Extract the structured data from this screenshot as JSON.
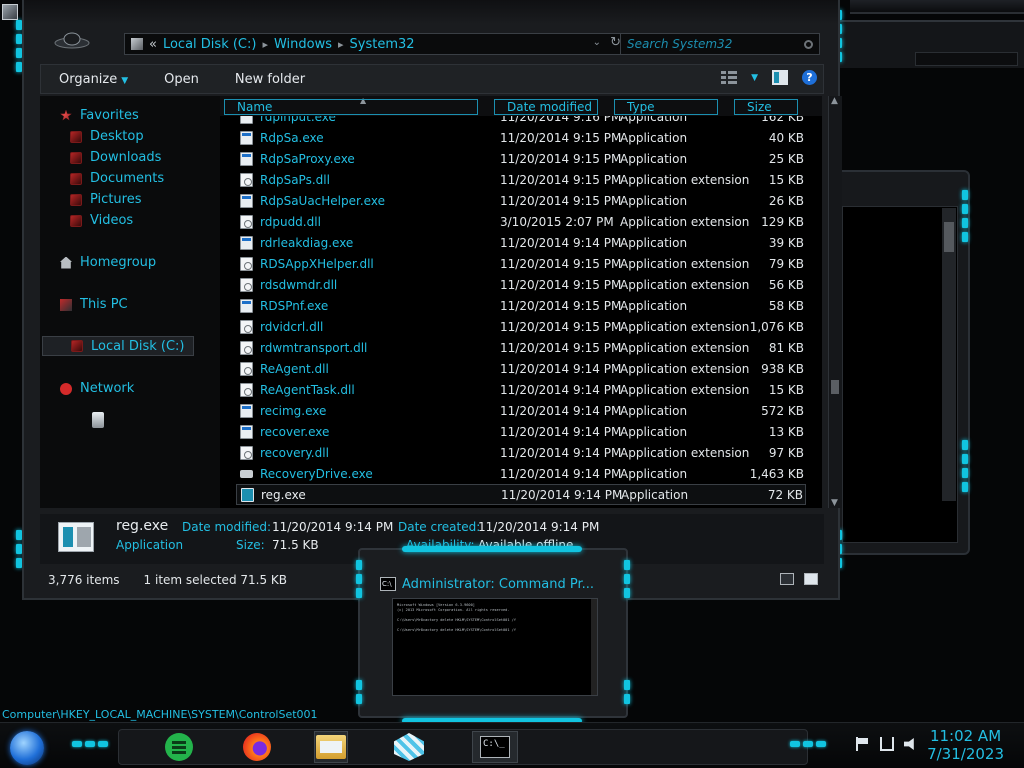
{
  "address": {
    "overflow": "«",
    "crumbs": [
      "Local Disk (C:)",
      "Windows",
      "System32"
    ],
    "separator": "▸"
  },
  "search": {
    "placeholder": "Search System32"
  },
  "toolbar": {
    "organize": "Organize",
    "open": "Open",
    "new_folder": "New folder"
  },
  "nav": {
    "favorites": "Favorites",
    "desktop": "Desktop",
    "downloads": "Downloads",
    "documents": "Documents",
    "pictures": "Pictures",
    "videos": "Videos",
    "homegroup": "Homegroup",
    "this_pc": "This PC",
    "local_disk": "Local Disk (C:)",
    "network": "Network"
  },
  "columns": {
    "name": "Name",
    "date": "Date modified",
    "type": "Type",
    "size": "Size"
  },
  "files": [
    {
      "name": "rdpinput.exe",
      "date": "11/20/2014 9:16 PM",
      "type": "Application",
      "size": "162 KB",
      "icon": "exe"
    },
    {
      "name": "RdpSa.exe",
      "date": "11/20/2014 9:15 PM",
      "type": "Application",
      "size": "40 KB",
      "icon": "exe"
    },
    {
      "name": "RdpSaProxy.exe",
      "date": "11/20/2014 9:15 PM",
      "type": "Application",
      "size": "25 KB",
      "icon": "exe"
    },
    {
      "name": "RdpSaPs.dll",
      "date": "11/20/2014 9:15 PM",
      "type": "Application extension",
      "size": "15 KB",
      "icon": "dll"
    },
    {
      "name": "RdpSaUacHelper.exe",
      "date": "11/20/2014 9:15 PM",
      "type": "Application",
      "size": "26 KB",
      "icon": "exe"
    },
    {
      "name": "rdpudd.dll",
      "date": "3/10/2015 2:07 PM",
      "type": "Application extension",
      "size": "129 KB",
      "icon": "dll"
    },
    {
      "name": "rdrleakdiag.exe",
      "date": "11/20/2014 9:14 PM",
      "type": "Application",
      "size": "39 KB",
      "icon": "exe"
    },
    {
      "name": "RDSAppXHelper.dll",
      "date": "11/20/2014 9:15 PM",
      "type": "Application extension",
      "size": "79 KB",
      "icon": "dll"
    },
    {
      "name": "rdsdwmdr.dll",
      "date": "11/20/2014 9:15 PM",
      "type": "Application extension",
      "size": "56 KB",
      "icon": "dll"
    },
    {
      "name": "RDSPnf.exe",
      "date": "11/20/2014 9:15 PM",
      "type": "Application",
      "size": "58 KB",
      "icon": "exe"
    },
    {
      "name": "rdvidcrl.dll",
      "date": "11/20/2014 9:15 PM",
      "type": "Application extension",
      "size": "1,076 KB",
      "icon": "dll"
    },
    {
      "name": "rdwmtransport.dll",
      "date": "11/20/2014 9:15 PM",
      "type": "Application extension",
      "size": "81 KB",
      "icon": "dll"
    },
    {
      "name": "ReAgent.dll",
      "date": "11/20/2014 9:14 PM",
      "type": "Application extension",
      "size": "938 KB",
      "icon": "dll"
    },
    {
      "name": "ReAgentTask.dll",
      "date": "11/20/2014 9:14 PM",
      "type": "Application extension",
      "size": "15 KB",
      "icon": "dll"
    },
    {
      "name": "recimg.exe",
      "date": "11/20/2014 9:14 PM",
      "type": "Application",
      "size": "572 KB",
      "icon": "exe"
    },
    {
      "name": "recover.exe",
      "date": "11/20/2014 9:14 PM",
      "type": "Application",
      "size": "13 KB",
      "icon": "exe"
    },
    {
      "name": "recovery.dll",
      "date": "11/20/2014 9:14 PM",
      "type": "Application extension",
      "size": "97 KB",
      "icon": "dll"
    },
    {
      "name": "RecoveryDrive.exe",
      "date": "11/20/2014 9:14 PM",
      "type": "Application",
      "size": "1,463 KB",
      "icon": "drive"
    },
    {
      "name": "reg.exe",
      "date": "11/20/2014 9:14 PM",
      "type": "Application",
      "size": "72 KB",
      "icon": "reg",
      "selected": true
    }
  ],
  "details": {
    "filename": "reg.exe",
    "kind": "Application",
    "date_modified_label": "Date modified:",
    "date_modified": "11/20/2014 9:14 PM",
    "size_label": "Size:",
    "size": "71.5 KB",
    "date_created_label": "Date created:",
    "date_created": "11/20/2014 9:14 PM",
    "availability_label": "Availability:",
    "availability": "Available offline"
  },
  "status": {
    "count": "3,776 items",
    "selection": "1 item selected  71.5 KB"
  },
  "cmd": {
    "title": "Administrator: Command Pr...",
    "lines": "Microsoft Windows [Version 6.3.9600]\n(c) 2013 Microsoft Corporation. All rights reserved.\n\nC:\\Users\\Mr8cactory delete HKLM\\SYSTEM\\ControlSet001 /f\n\nC:\\Users\\Mr8cactory delete HKLM\\SYSTEM\\ControlSet001 /f"
  },
  "registry_path": "Computer\\HKEY_LOCAL_MACHINE\\SYSTEM\\ControlSet001",
  "clock": {
    "time": "11:02 AM",
    "date": "7/31/2023"
  },
  "theme": {
    "accent": "#23bfe3",
    "glow": "#11c4e0",
    "background": "#050607"
  }
}
